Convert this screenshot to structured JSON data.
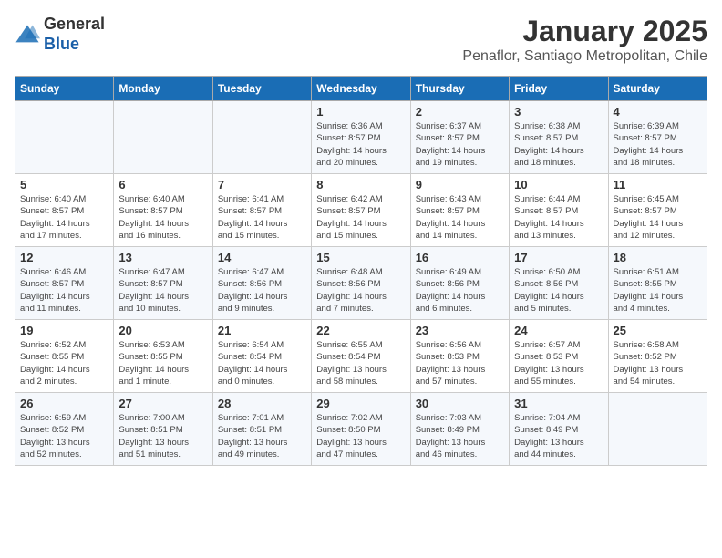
{
  "header": {
    "logo_general": "General",
    "logo_blue": "Blue",
    "month_title": "January 2025",
    "location": "Penaflor, Santiago Metropolitan, Chile"
  },
  "days_of_week": [
    "Sunday",
    "Monday",
    "Tuesday",
    "Wednesday",
    "Thursday",
    "Friday",
    "Saturday"
  ],
  "weeks": [
    [
      {
        "day": "",
        "info": ""
      },
      {
        "day": "",
        "info": ""
      },
      {
        "day": "",
        "info": ""
      },
      {
        "day": "1",
        "info": "Sunrise: 6:36 AM\nSunset: 8:57 PM\nDaylight: 14 hours\nand 20 minutes."
      },
      {
        "day": "2",
        "info": "Sunrise: 6:37 AM\nSunset: 8:57 PM\nDaylight: 14 hours\nand 19 minutes."
      },
      {
        "day": "3",
        "info": "Sunrise: 6:38 AM\nSunset: 8:57 PM\nDaylight: 14 hours\nand 18 minutes."
      },
      {
        "day": "4",
        "info": "Sunrise: 6:39 AM\nSunset: 8:57 PM\nDaylight: 14 hours\nand 18 minutes."
      }
    ],
    [
      {
        "day": "5",
        "info": "Sunrise: 6:40 AM\nSunset: 8:57 PM\nDaylight: 14 hours\nand 17 minutes."
      },
      {
        "day": "6",
        "info": "Sunrise: 6:40 AM\nSunset: 8:57 PM\nDaylight: 14 hours\nand 16 minutes."
      },
      {
        "day": "7",
        "info": "Sunrise: 6:41 AM\nSunset: 8:57 PM\nDaylight: 14 hours\nand 15 minutes."
      },
      {
        "day": "8",
        "info": "Sunrise: 6:42 AM\nSunset: 8:57 PM\nDaylight: 14 hours\nand 15 minutes."
      },
      {
        "day": "9",
        "info": "Sunrise: 6:43 AM\nSunset: 8:57 PM\nDaylight: 14 hours\nand 14 minutes."
      },
      {
        "day": "10",
        "info": "Sunrise: 6:44 AM\nSunset: 8:57 PM\nDaylight: 14 hours\nand 13 minutes."
      },
      {
        "day": "11",
        "info": "Sunrise: 6:45 AM\nSunset: 8:57 PM\nDaylight: 14 hours\nand 12 minutes."
      }
    ],
    [
      {
        "day": "12",
        "info": "Sunrise: 6:46 AM\nSunset: 8:57 PM\nDaylight: 14 hours\nand 11 minutes."
      },
      {
        "day": "13",
        "info": "Sunrise: 6:47 AM\nSunset: 8:57 PM\nDaylight: 14 hours\nand 10 minutes."
      },
      {
        "day": "14",
        "info": "Sunrise: 6:47 AM\nSunset: 8:56 PM\nDaylight: 14 hours\nand 9 minutes."
      },
      {
        "day": "15",
        "info": "Sunrise: 6:48 AM\nSunset: 8:56 PM\nDaylight: 14 hours\nand 7 minutes."
      },
      {
        "day": "16",
        "info": "Sunrise: 6:49 AM\nSunset: 8:56 PM\nDaylight: 14 hours\nand 6 minutes."
      },
      {
        "day": "17",
        "info": "Sunrise: 6:50 AM\nSunset: 8:56 PM\nDaylight: 14 hours\nand 5 minutes."
      },
      {
        "day": "18",
        "info": "Sunrise: 6:51 AM\nSunset: 8:55 PM\nDaylight: 14 hours\nand 4 minutes."
      }
    ],
    [
      {
        "day": "19",
        "info": "Sunrise: 6:52 AM\nSunset: 8:55 PM\nDaylight: 14 hours\nand 2 minutes."
      },
      {
        "day": "20",
        "info": "Sunrise: 6:53 AM\nSunset: 8:55 PM\nDaylight: 14 hours\nand 1 minute."
      },
      {
        "day": "21",
        "info": "Sunrise: 6:54 AM\nSunset: 8:54 PM\nDaylight: 14 hours\nand 0 minutes."
      },
      {
        "day": "22",
        "info": "Sunrise: 6:55 AM\nSunset: 8:54 PM\nDaylight: 13 hours\nand 58 minutes."
      },
      {
        "day": "23",
        "info": "Sunrise: 6:56 AM\nSunset: 8:53 PM\nDaylight: 13 hours\nand 57 minutes."
      },
      {
        "day": "24",
        "info": "Sunrise: 6:57 AM\nSunset: 8:53 PM\nDaylight: 13 hours\nand 55 minutes."
      },
      {
        "day": "25",
        "info": "Sunrise: 6:58 AM\nSunset: 8:52 PM\nDaylight: 13 hours\nand 54 minutes."
      }
    ],
    [
      {
        "day": "26",
        "info": "Sunrise: 6:59 AM\nSunset: 8:52 PM\nDaylight: 13 hours\nand 52 minutes."
      },
      {
        "day": "27",
        "info": "Sunrise: 7:00 AM\nSunset: 8:51 PM\nDaylight: 13 hours\nand 51 minutes."
      },
      {
        "day": "28",
        "info": "Sunrise: 7:01 AM\nSunset: 8:51 PM\nDaylight: 13 hours\nand 49 minutes."
      },
      {
        "day": "29",
        "info": "Sunrise: 7:02 AM\nSunset: 8:50 PM\nDaylight: 13 hours\nand 47 minutes."
      },
      {
        "day": "30",
        "info": "Sunrise: 7:03 AM\nSunset: 8:49 PM\nDaylight: 13 hours\nand 46 minutes."
      },
      {
        "day": "31",
        "info": "Sunrise: 7:04 AM\nSunset: 8:49 PM\nDaylight: 13 hours\nand 44 minutes."
      },
      {
        "day": "",
        "info": ""
      }
    ]
  ]
}
